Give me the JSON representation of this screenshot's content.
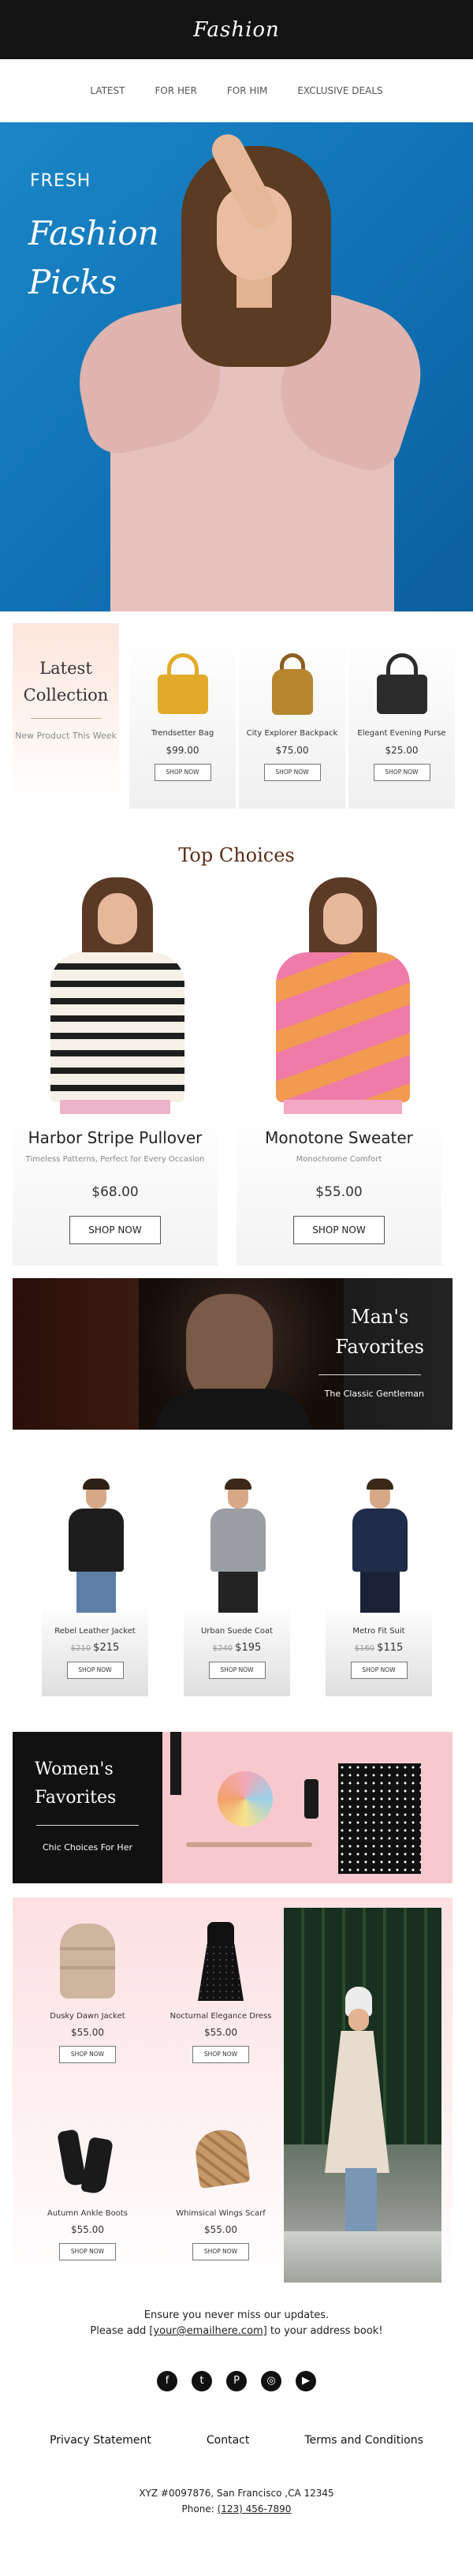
{
  "brand": {
    "logo": "Fashion"
  },
  "nav": [
    "LATEST",
    "FOR HER",
    "FOR HIM",
    "EXCLUSIVE DEALS"
  ],
  "hero": {
    "kicker": "FRESH",
    "script_line1": "Fashion",
    "script_line2": "Picks"
  },
  "latest": {
    "title_line1": "Latest",
    "title_line2": "Collection",
    "subtitle": "New Product This Week",
    "products": [
      {
        "name": "Trendsetter Bag",
        "price": "$99.00",
        "cta": "SHOP NOW",
        "color": "#e2aa2a"
      },
      {
        "name": "City Explorer Backpack",
        "price": "$75.00",
        "cta": "SHOP NOW",
        "color": "#b7862f"
      },
      {
        "name": "Elegant Evening Purse",
        "price": "$25.00",
        "cta": "SHOP NOW",
        "color": "#2b2b2b"
      }
    ]
  },
  "top_choices": {
    "title": "Top Choices",
    "items": [
      {
        "name": "Harbor Stripe Pullover",
        "desc": "Timeless Patterns, Perfect for Every Occasion",
        "price": "$68.00",
        "cta": "SHOP NOW"
      },
      {
        "name": "Monotone Sweater",
        "desc": "Monochrome Comfort",
        "price": "$55.00",
        "cta": "SHOP NOW"
      }
    ]
  },
  "mens_banner": {
    "title_line1": "Man's",
    "title_line2": "Favorites",
    "subtitle": "The Classic Gentleman"
  },
  "mens_products": [
    {
      "name": "Rebel Leather Jacket",
      "old": "$210",
      "price": "$215",
      "cta": "SHOP NOW"
    },
    {
      "name": "Urban Suede Coat",
      "old": "$240",
      "price": "$195",
      "cta": "SHOP NOW"
    },
    {
      "name": "Metro Fit Suit",
      "old": "$160",
      "price": "$115",
      "cta": "SHOP NOW"
    }
  ],
  "womens_banner": {
    "title_line1": "Women's",
    "title_line2": "Favorites",
    "subtitle": "Chic Choices For Her"
  },
  "womens_products": [
    {
      "name": "Dusky Dawn Jacket",
      "price": "$55.00",
      "cta": "SHOP NOW"
    },
    {
      "name": "Nocturnal Elegance Dress",
      "price": "$55.00",
      "cta": "SHOP NOW"
    },
    {
      "name": "Autumn Ankle Boots",
      "price": "$55.00",
      "cta": "SHOP NOW"
    },
    {
      "name": "Whimsical Wings Scarf",
      "price": "$55.00",
      "cta": "SHOP NOW"
    }
  ],
  "footer": {
    "line1": "Ensure you never miss our updates.",
    "line2_pre": "Please add ",
    "email": "[your@emailhere.com]",
    "line2_post": " to your address book!",
    "social": [
      "f",
      "t",
      "p",
      "ig",
      "yt"
    ],
    "links": [
      "Privacy Statement",
      "Contact",
      "Terms and Conditions"
    ],
    "address": "XYZ #0097876, San Francisco ,CA 12345",
    "phone_label": "Phone: ",
    "phone": "(123) 456-7890"
  }
}
